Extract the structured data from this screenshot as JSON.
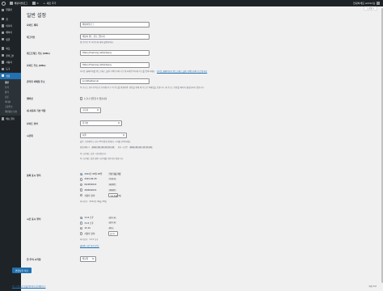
{
  "adminbar": {
    "site_name": "해랑이블로그",
    "comments": "0",
    "new": "새로 추가",
    "greeting": "안녕하세요 admin님"
  },
  "sidebar": {
    "items": [
      {
        "label": "알림판"
      },
      {
        "label": "글"
      },
      {
        "label": "미디어"
      },
      {
        "label": "페이지"
      },
      {
        "label": "댓글"
      },
      {
        "label": "외모"
      },
      {
        "label": "플러그인"
      },
      {
        "label": "사용자"
      },
      {
        "label": "도구"
      },
      {
        "label": "설정"
      }
    ],
    "submenu": [
      "일반",
      "쓰기",
      "읽기",
      "토론",
      "미디어",
      "고유주소",
      "개인정보 보호"
    ],
    "collapse": "메뉴 접기"
  },
  "help_tab": "도움말 ▾",
  "page_title": "일반 설정",
  "fields": {
    "site_title": {
      "label": "사이트 제목",
      "value": "해랑이블로그"
    },
    "tagline": {
      "label": "태그라인",
      "value": "해랑이 워드 블로그입니다",
      "desc": "몇 단어로 이 사이트에 대해 설명하세요."
    },
    "wp_address": {
      "label": "워드프레스 주소 (URL)",
      "value": "https://haerang.net/wdpeny"
    },
    "site_address": {
      "label": "사이트 주소 (URL)",
      "value": "https://haerang.net/wdpeny",
      "desc": "사이트 홈페이지를 워드프레스 설치 디렉토리와 다르게 하려면 여기에 주소를 입력하세요.",
      "link": "사이트 홈페이지가 워드프레스 설치 디렉토리와 다르게 하기"
    },
    "admin_email": {
      "label": "관리자 이메일 주소",
      "value": "son@testserver",
      "desc": "이 주소는 관리 목적으로 사용됩니다. 이 주소를 변경하면, 확인을 위해 새 주소로 이메일을 보냅니다. 새 주소는 확인될 때까지 활성화되지 않습니다."
    },
    "membership": {
      "label": "멤버십",
      "checkbox": "누구나 가입할 수 있습니다"
    },
    "default_role": {
      "label": "새 사용자 기본 역할",
      "value": "구독자"
    },
    "site_language": {
      "label": "사이트 언어",
      "value": "한국어"
    },
    "timezone": {
      "label": "시간대",
      "value": "서울",
      "desc": "같은 시간대의 도시나 UTC(협정 세계시) 시차를 선택하세요.",
      "utc_label": "협정세계시:",
      "utc_value": "2022-06-28 06:15:26",
      "local_label": "현지 시간은",
      "local_value": "2022-06-28 15:15:26",
      "dst_note": "이 시간대는 표준 시간대입니다.",
      "dst_note2": "이 시간대는 일광 절약 시간제를 사용하지 않습니다."
    },
    "date_format": {
      "label": "날짜 표시 형식",
      "options": [
        {
          "label": "2022년 06월 28일",
          "code": "Y년 m월 d일"
        },
        {
          "label": "2022-06-28",
          "code": "Y-m-d"
        },
        {
          "label": "06/28/2022",
          "code": "m/d/Y"
        },
        {
          "label": "28/06/2022",
          "code": "d/m/Y"
        },
        {
          "label": "사용자 정의:",
          "code": "Y년 m월 d일"
        }
      ],
      "preview_label": "미리보기:",
      "preview_value": "2022년 06월 28일"
    },
    "time_format": {
      "label": "시간 표시 형식",
      "options": [
        {
          "label": "3:15 오후",
          "code": "g:i a"
        },
        {
          "label": "3:15 오후",
          "code": "g:i A"
        },
        {
          "label": "15:15",
          "code": "H:i"
        },
        {
          "label": "사용자 정의:",
          "code": "g:i a"
        }
      ],
      "preview_label": "미리보기:",
      "preview_value": "3:15 오후",
      "doc_link": "날짜와 시간 형식 문서."
    },
    "week_start": {
      "label": "한 주의 시작일",
      "value": "월요일"
    }
  },
  "save_button": "변경사항 저장",
  "footer": {
    "left": "워드프레스로 만들어주셔서 감사합니다.",
    "right": "버전 6.0"
  }
}
